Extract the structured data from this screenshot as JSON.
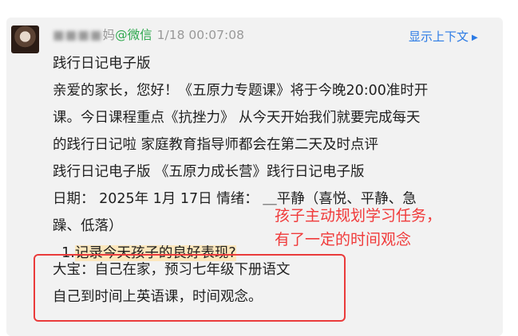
{
  "message": {
    "sender_suffix": "妈",
    "source": "@微信",
    "time": "1/18 00:07:08",
    "context_link": "显示上下文",
    "lines": [
      "践行日记电子版",
      "亲爱的家长，您好！《五原力专题课》将于今晚20:00准时开",
      "课。今日课程重点《抗挫力》 从今天开始我们就要完成每天",
      "的践行日记啦 家庭教育指导师都会在第二天及时点评",
      "践行日记电子版 《五原力成长营》践行日记电子版",
      "日期： 2025年 1月 17日 情绪： ＿平静（喜悦、平静、急",
      "躁、低落）"
    ],
    "question_number": "1.",
    "question_text": "记录今天孩子的良好表现?",
    "answer_lines": [
      "大宝：自己在家，预习七年级下册语文",
      "自己到时间上英语课，时间观念。"
    ]
  },
  "annotation": {
    "note_lines": [
      "孩子主动规划学习任务，",
      "有了一定的时间观念"
    ],
    "color": "#f03a3a"
  },
  "colors": {
    "source_green": "#2fa84f",
    "link_blue": "#2c7be5",
    "highlight": "#fce7bd",
    "card_bg": "#f2f2f2"
  }
}
